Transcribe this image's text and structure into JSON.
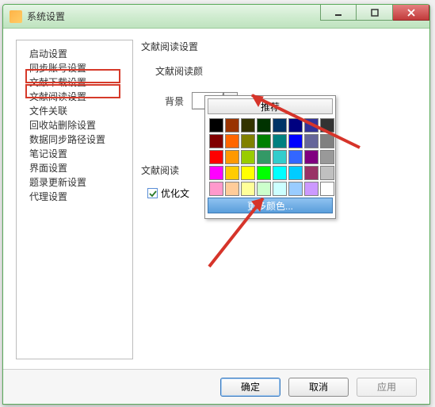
{
  "window": {
    "title": "系统设置"
  },
  "nav": {
    "items": [
      "启动设置",
      "同步账号设置",
      "文献下载设置",
      "文献阅读设置",
      "文件关联",
      "回收站删除设置",
      "数据同步路径设置",
      "笔记设置",
      "界面设置",
      "题录更新设置",
      "代理设置"
    ],
    "highlighted_indices": [
      2,
      3
    ]
  },
  "panel": {
    "section1_title": "文献阅读设置",
    "section1_sub": "文献阅读颜",
    "bg_label": "背景",
    "section2_title": "文献阅读",
    "optimize_label": "优化文"
  },
  "picker": {
    "recommend": "推荐",
    "more": "更多颜色...",
    "colors": [
      "#000000",
      "#993300",
      "#333300",
      "#003300",
      "#003366",
      "#000080",
      "#333399",
      "#333333",
      "#800000",
      "#ff6600",
      "#808000",
      "#008000",
      "#008080",
      "#0000ff",
      "#666699",
      "#808080",
      "#ff0000",
      "#ff9900",
      "#99cc00",
      "#339966",
      "#33cccc",
      "#3366ff",
      "#800080",
      "#999999",
      "#ff00ff",
      "#ffcc00",
      "#ffff00",
      "#00ff00",
      "#00ffff",
      "#00ccff",
      "#993366",
      "#c0c0c0",
      "#ff99cc",
      "#ffcc99",
      "#ffff99",
      "#ccffcc",
      "#ccffff",
      "#99ccff",
      "#cc99ff",
      "#ffffff"
    ]
  },
  "footer": {
    "ok": "确定",
    "cancel": "取消",
    "apply": "应用"
  }
}
